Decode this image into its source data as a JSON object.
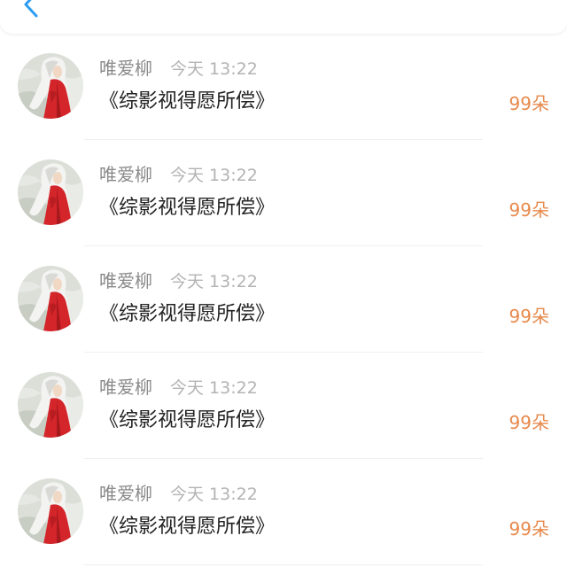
{
  "header": {
    "back_icon": "chevron-left-icon"
  },
  "colors": {
    "accent_blue": "#2b9cf2",
    "count_orange": "#e7894b",
    "username_gray": "#8a8a8a",
    "time_gray": "#b3b3b3",
    "title_dark": "#222222"
  },
  "items": [
    {
      "avatar_icon": "user-avatar-icon",
      "user": "唯爱柳",
      "time": "今天 13:22",
      "title": "《综影视得愿所偿》",
      "count": "99朵"
    },
    {
      "avatar_icon": "user-avatar-icon",
      "user": "唯爱柳",
      "time": "今天 13:22",
      "title": "《综影视得愿所偿》",
      "count": "99朵"
    },
    {
      "avatar_icon": "user-avatar-icon",
      "user": "唯爱柳",
      "time": "今天 13:22",
      "title": "《综影视得愿所偿》",
      "count": "99朵"
    },
    {
      "avatar_icon": "user-avatar-icon",
      "user": "唯爱柳",
      "time": "今天 13:22",
      "title": "《综影视得愿所偿》",
      "count": "99朵"
    },
    {
      "avatar_icon": "user-avatar-icon",
      "user": "唯爱柳",
      "time": "今天 13:22",
      "title": "《综影视得愿所偿》",
      "count": "99朵"
    }
  ]
}
